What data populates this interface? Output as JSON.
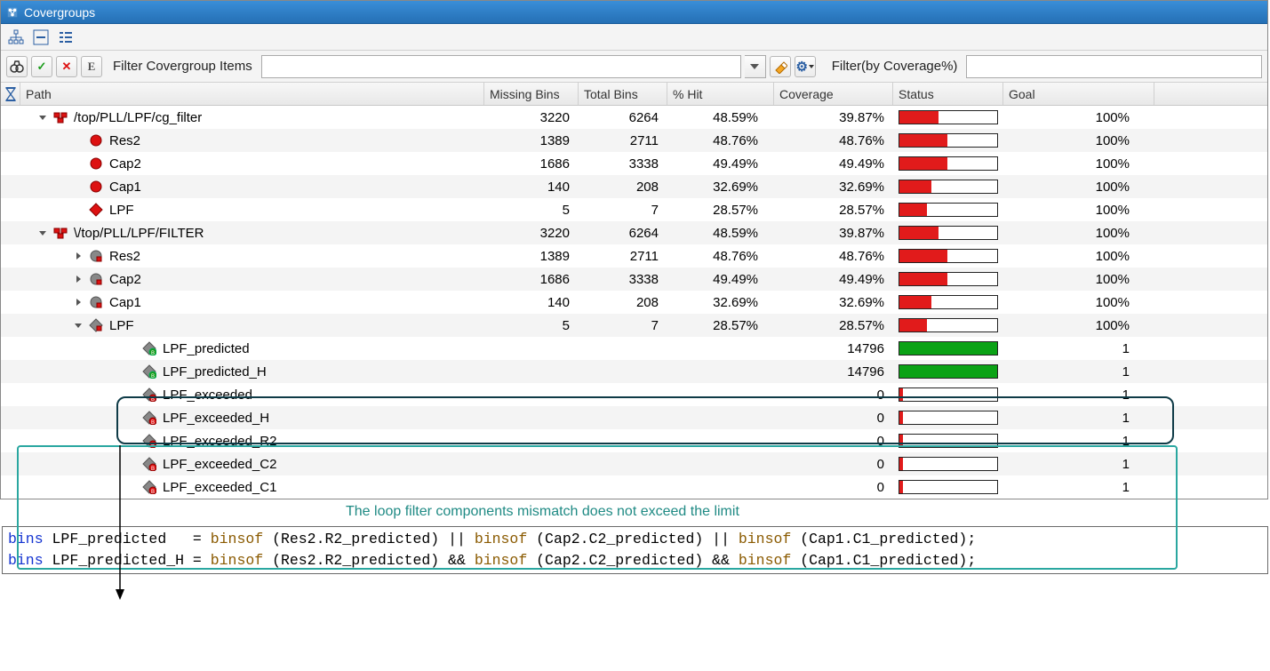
{
  "window": {
    "title": "Covergroups"
  },
  "toolbar": {
    "binoculars": "🔍",
    "check": "✓",
    "cross": "✕",
    "e_btn": "E",
    "filter_label": "Filter Covergroup Items",
    "filter_value": "",
    "eraser": "🧽",
    "gear": "⚙",
    "filter2_label": "Filter(by Coverage%)",
    "filter2_value": ""
  },
  "columns": {
    "path": "Path",
    "missing": "Missing Bins",
    "total": "Total Bins",
    "hit": "% Hit",
    "coverage": "Coverage",
    "status": "Status",
    "goal": "Goal"
  },
  "rows": [
    {
      "indent": 1,
      "exp": "down",
      "icon": "covergroup",
      "label": "/top/PLL/LPF/cg_filter",
      "miss": "3220",
      "total": "6264",
      "hit": "48.59%",
      "cov": "39.87%",
      "bar": 39.87,
      "bar_color": "red",
      "goal": "100%"
    },
    {
      "indent": 2,
      "exp": "",
      "icon": "coverpoint-red",
      "label": "Res2",
      "miss": "1389",
      "total": "2711",
      "hit": "48.76%",
      "cov": "48.76%",
      "bar": 48.76,
      "bar_color": "red",
      "goal": "100%"
    },
    {
      "indent": 2,
      "exp": "",
      "icon": "coverpoint-red",
      "label": "Cap2",
      "miss": "1686",
      "total": "3338",
      "hit": "49.49%",
      "cov": "49.49%",
      "bar": 49.49,
      "bar_color": "red",
      "goal": "100%"
    },
    {
      "indent": 2,
      "exp": "",
      "icon": "coverpoint-red",
      "label": "Cap1",
      "miss": "140",
      "total": "208",
      "hit": "32.69%",
      "cov": "32.69%",
      "bar": 32.69,
      "bar_color": "red",
      "goal": "100%"
    },
    {
      "indent": 2,
      "exp": "",
      "icon": "cross-red",
      "label": "LPF",
      "miss": "5",
      "total": "7",
      "hit": "28.57%",
      "cov": "28.57%",
      "bar": 28.57,
      "bar_color": "red",
      "goal": "100%"
    },
    {
      "indent": 1,
      "exp": "down",
      "icon": "covergroup",
      "label": "\\/top/PLL/LPF/FILTER",
      "miss": "3220",
      "total": "6264",
      "hit": "48.59%",
      "cov": "39.87%",
      "bar": 39.87,
      "bar_color": "red",
      "goal": "100%"
    },
    {
      "indent": 2,
      "exp": "right",
      "icon": "coverpoint-gray",
      "label": "Res2",
      "miss": "1389",
      "total": "2711",
      "hit": "48.76%",
      "cov": "48.76%",
      "bar": 48.76,
      "bar_color": "red",
      "goal": "100%"
    },
    {
      "indent": 2,
      "exp": "right",
      "icon": "coverpoint-gray",
      "label": "Cap2",
      "miss": "1686",
      "total": "3338",
      "hit": "49.49%",
      "cov": "49.49%",
      "bar": 49.49,
      "bar_color": "red",
      "goal": "100%"
    },
    {
      "indent": 2,
      "exp": "right",
      "icon": "coverpoint-gray",
      "label": "Cap1",
      "miss": "140",
      "total": "208",
      "hit": "32.69%",
      "cov": "32.69%",
      "bar": 32.69,
      "bar_color": "red",
      "goal": "100%"
    },
    {
      "indent": 2,
      "exp": "down",
      "icon": "cross-gray",
      "label": "LPF",
      "miss": "5",
      "total": "7",
      "hit": "28.57%",
      "cov": "28.57%",
      "bar": 28.57,
      "bar_color": "red",
      "goal": "100%"
    },
    {
      "indent": 4,
      "exp": "",
      "icon": "bin-green",
      "label": "LPF_predicted",
      "miss": "",
      "total": "",
      "hit": "",
      "cov": "14796",
      "bar": 100,
      "bar_color": "green",
      "goal": "1"
    },
    {
      "indent": 4,
      "exp": "",
      "icon": "bin-green",
      "label": "LPF_predicted_H",
      "miss": "",
      "total": "",
      "hit": "",
      "cov": "14796",
      "bar": 100,
      "bar_color": "green",
      "goal": "1"
    },
    {
      "indent": 4,
      "exp": "",
      "icon": "bin-red",
      "label": "LPF_exceeded",
      "miss": "",
      "total": "",
      "hit": "",
      "cov": "0",
      "bar": 0,
      "bar_color": "tick",
      "goal": "1"
    },
    {
      "indent": 4,
      "exp": "",
      "icon": "bin-red",
      "label": "LPF_exceeded_H",
      "miss": "",
      "total": "",
      "hit": "",
      "cov": "0",
      "bar": 0,
      "bar_color": "tick",
      "goal": "1"
    },
    {
      "indent": 4,
      "exp": "",
      "icon": "bin-red",
      "label": "LPF_exceeded_R2",
      "miss": "",
      "total": "",
      "hit": "",
      "cov": "0",
      "bar": 0,
      "bar_color": "tick",
      "goal": "1"
    },
    {
      "indent": 4,
      "exp": "",
      "icon": "bin-red",
      "label": "LPF_exceeded_C2",
      "miss": "",
      "total": "",
      "hit": "",
      "cov": "0",
      "bar": 0,
      "bar_color": "tick",
      "goal": "1"
    },
    {
      "indent": 4,
      "exp": "",
      "icon": "bin-red",
      "label": "LPF_exceeded_C1",
      "miss": "",
      "total": "",
      "hit": "",
      "cov": "0",
      "bar": 0,
      "bar_color": "tick",
      "goal": "1"
    }
  ],
  "annotation": {
    "text": "The loop filter components mismatch does not exceed the limit"
  },
  "code": {
    "kw_bins": "bins",
    "fn_binsof": "binsof",
    "l1_lhs": " LPF_predicted   = ",
    "l1_p1": " (Res2.R2_predicted) || ",
    "l1_p2": " (Cap2.C2_predicted) || ",
    "l1_p3": " (Cap1.C1_predicted);",
    "l2_lhs": " LPF_predicted_H = ",
    "l2_p1": " (Res2.R2_predicted) && ",
    "l2_p2": " (Cap2.C2_predicted) && ",
    "l2_p3": " (Cap1.C1_predicted);"
  }
}
